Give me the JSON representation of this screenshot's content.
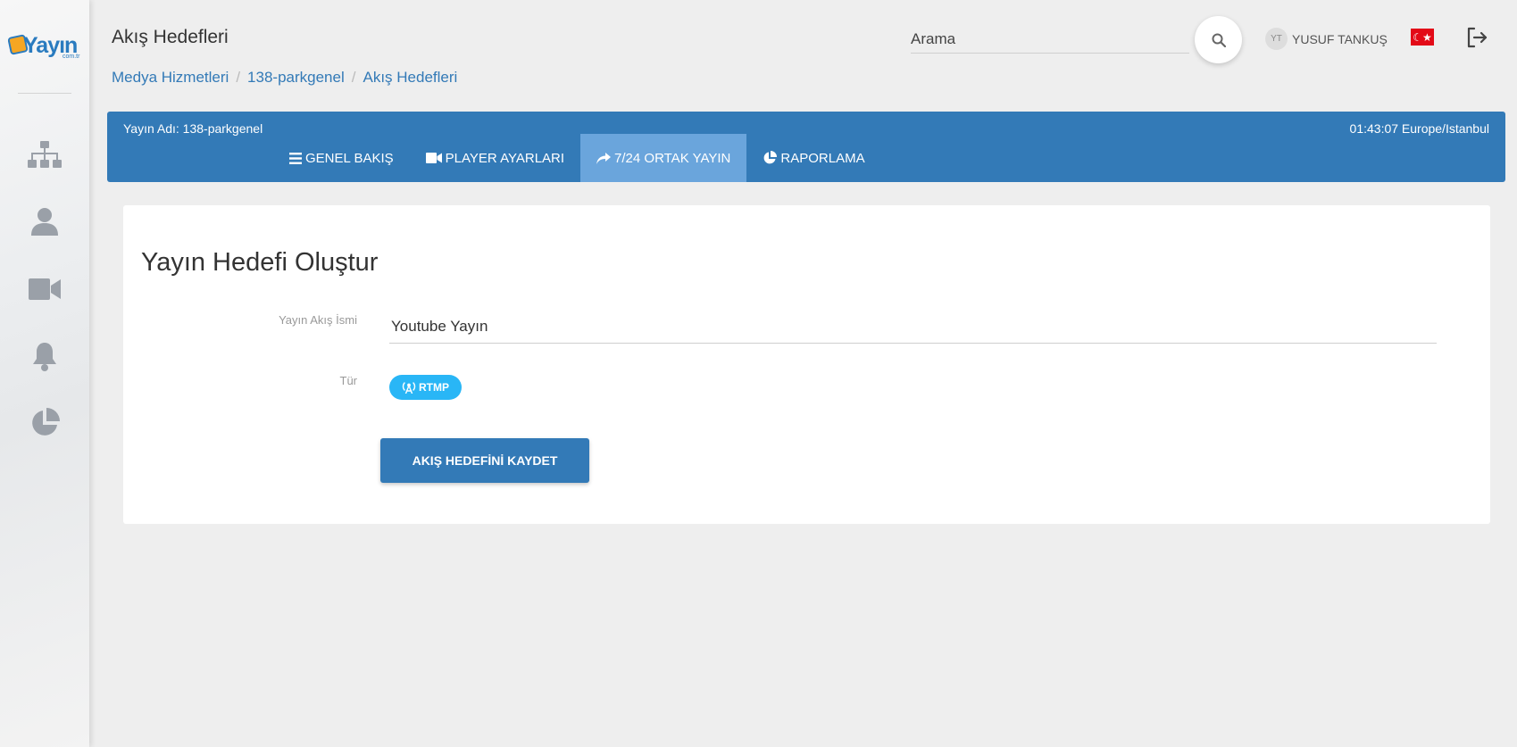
{
  "logo": {
    "text": "Yayın",
    "sub": "com.tr"
  },
  "sidebar": {
    "items": [
      {
        "icon": "sitemap-icon"
      },
      {
        "icon": "user-icon"
      },
      {
        "icon": "video-camera-icon"
      },
      {
        "icon": "bell-icon"
      },
      {
        "icon": "pie-chart-icon"
      }
    ]
  },
  "header": {
    "title": "Akış Hedefleri",
    "breadcrumb": [
      "Medya Hizmetleri",
      "138-parkgenel",
      "Akış Hedefleri"
    ],
    "search_placeholder": "Arama",
    "user_initials": "YT",
    "user_name": "YUSUF TANKUŞ"
  },
  "stream_bar": {
    "stream_name": "Yayın Adı: 138-parkgenel",
    "clock": "01:43:07 Europe/Istanbul",
    "tabs": [
      {
        "label": "GENEL BAKIŞ",
        "icon": "list-icon",
        "active": false
      },
      {
        "label": "PLAYER AYARLARI",
        "icon": "video-camera-icon",
        "active": false
      },
      {
        "label": "7/24 ORTAK YAYIN",
        "icon": "share-icon",
        "active": true
      },
      {
        "label": "RAPORLAMA",
        "icon": "pie-chart-icon",
        "active": false
      }
    ]
  },
  "form": {
    "title": "Yayın Hedefi Oluştur",
    "name_label": "Yayın Akış İsmi",
    "name_value": "Youtube Yayın",
    "type_label": "Tür",
    "type_value": "RTMP",
    "save_label": "AKIŞ HEDEFİNİ KAYDET"
  },
  "colors": {
    "primary": "#337ab7",
    "tab_active": "#6aa5dc",
    "chip": "#29b6f6",
    "flag": "#e30a17"
  }
}
